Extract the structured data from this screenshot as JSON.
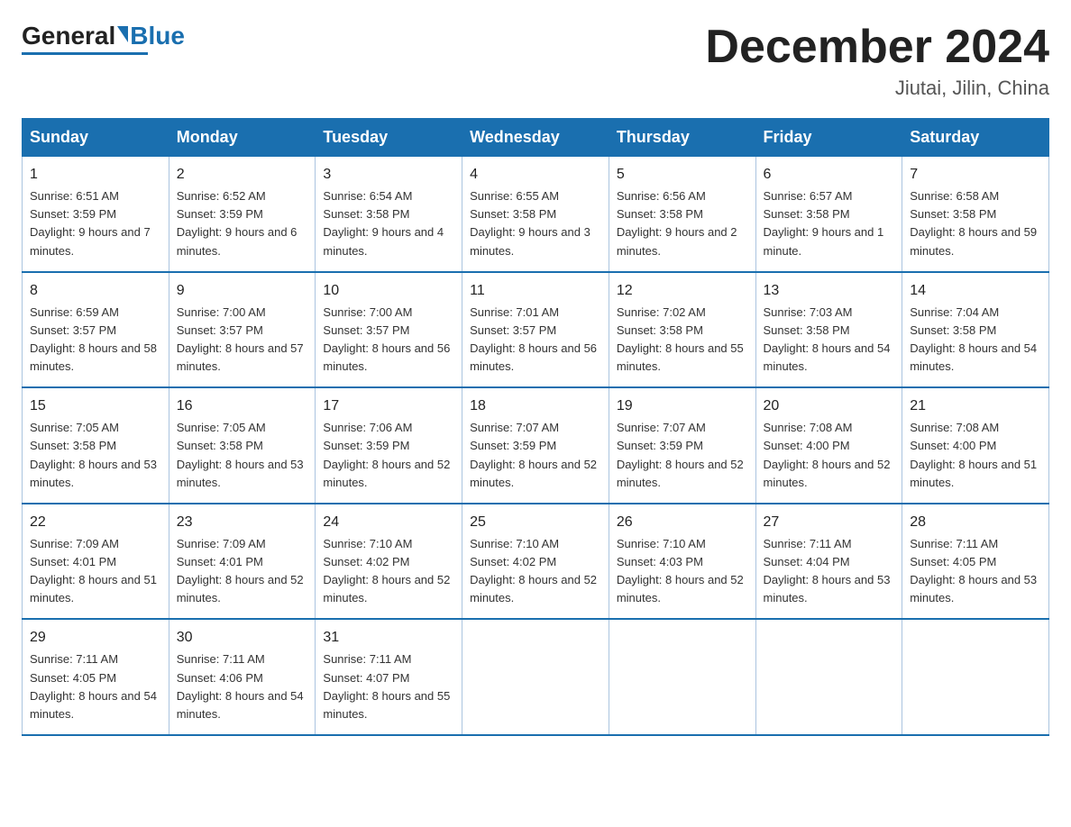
{
  "header": {
    "logo_general": "General",
    "logo_blue": "Blue",
    "month_title": "December 2024",
    "subtitle": "Jiutai, Jilin, China"
  },
  "weekdays": [
    "Sunday",
    "Monday",
    "Tuesday",
    "Wednesday",
    "Thursday",
    "Friday",
    "Saturday"
  ],
  "weeks": [
    [
      {
        "day": "1",
        "sunrise": "6:51 AM",
        "sunset": "3:59 PM",
        "daylight": "9 hours and 7 minutes."
      },
      {
        "day": "2",
        "sunrise": "6:52 AM",
        "sunset": "3:59 PM",
        "daylight": "9 hours and 6 minutes."
      },
      {
        "day": "3",
        "sunrise": "6:54 AM",
        "sunset": "3:58 PM",
        "daylight": "9 hours and 4 minutes."
      },
      {
        "day": "4",
        "sunrise": "6:55 AM",
        "sunset": "3:58 PM",
        "daylight": "9 hours and 3 minutes."
      },
      {
        "day": "5",
        "sunrise": "6:56 AM",
        "sunset": "3:58 PM",
        "daylight": "9 hours and 2 minutes."
      },
      {
        "day": "6",
        "sunrise": "6:57 AM",
        "sunset": "3:58 PM",
        "daylight": "9 hours and 1 minute."
      },
      {
        "day": "7",
        "sunrise": "6:58 AM",
        "sunset": "3:58 PM",
        "daylight": "8 hours and 59 minutes."
      }
    ],
    [
      {
        "day": "8",
        "sunrise": "6:59 AM",
        "sunset": "3:57 PM",
        "daylight": "8 hours and 58 minutes."
      },
      {
        "day": "9",
        "sunrise": "7:00 AM",
        "sunset": "3:57 PM",
        "daylight": "8 hours and 57 minutes."
      },
      {
        "day": "10",
        "sunrise": "7:00 AM",
        "sunset": "3:57 PM",
        "daylight": "8 hours and 56 minutes."
      },
      {
        "day": "11",
        "sunrise": "7:01 AM",
        "sunset": "3:57 PM",
        "daylight": "8 hours and 56 minutes."
      },
      {
        "day": "12",
        "sunrise": "7:02 AM",
        "sunset": "3:58 PM",
        "daylight": "8 hours and 55 minutes."
      },
      {
        "day": "13",
        "sunrise": "7:03 AM",
        "sunset": "3:58 PM",
        "daylight": "8 hours and 54 minutes."
      },
      {
        "day": "14",
        "sunrise": "7:04 AM",
        "sunset": "3:58 PM",
        "daylight": "8 hours and 54 minutes."
      }
    ],
    [
      {
        "day": "15",
        "sunrise": "7:05 AM",
        "sunset": "3:58 PM",
        "daylight": "8 hours and 53 minutes."
      },
      {
        "day": "16",
        "sunrise": "7:05 AM",
        "sunset": "3:58 PM",
        "daylight": "8 hours and 53 minutes."
      },
      {
        "day": "17",
        "sunrise": "7:06 AM",
        "sunset": "3:59 PM",
        "daylight": "8 hours and 52 minutes."
      },
      {
        "day": "18",
        "sunrise": "7:07 AM",
        "sunset": "3:59 PM",
        "daylight": "8 hours and 52 minutes."
      },
      {
        "day": "19",
        "sunrise": "7:07 AM",
        "sunset": "3:59 PM",
        "daylight": "8 hours and 52 minutes."
      },
      {
        "day": "20",
        "sunrise": "7:08 AM",
        "sunset": "4:00 PM",
        "daylight": "8 hours and 52 minutes."
      },
      {
        "day": "21",
        "sunrise": "7:08 AM",
        "sunset": "4:00 PM",
        "daylight": "8 hours and 51 minutes."
      }
    ],
    [
      {
        "day": "22",
        "sunrise": "7:09 AM",
        "sunset": "4:01 PM",
        "daylight": "8 hours and 51 minutes."
      },
      {
        "day": "23",
        "sunrise": "7:09 AM",
        "sunset": "4:01 PM",
        "daylight": "8 hours and 52 minutes."
      },
      {
        "day": "24",
        "sunrise": "7:10 AM",
        "sunset": "4:02 PM",
        "daylight": "8 hours and 52 minutes."
      },
      {
        "day": "25",
        "sunrise": "7:10 AM",
        "sunset": "4:02 PM",
        "daylight": "8 hours and 52 minutes."
      },
      {
        "day": "26",
        "sunrise": "7:10 AM",
        "sunset": "4:03 PM",
        "daylight": "8 hours and 52 minutes."
      },
      {
        "day": "27",
        "sunrise": "7:11 AM",
        "sunset": "4:04 PM",
        "daylight": "8 hours and 53 minutes."
      },
      {
        "day": "28",
        "sunrise": "7:11 AM",
        "sunset": "4:05 PM",
        "daylight": "8 hours and 53 minutes."
      }
    ],
    [
      {
        "day": "29",
        "sunrise": "7:11 AM",
        "sunset": "4:05 PM",
        "daylight": "8 hours and 54 minutes."
      },
      {
        "day": "30",
        "sunrise": "7:11 AM",
        "sunset": "4:06 PM",
        "daylight": "8 hours and 54 minutes."
      },
      {
        "day": "31",
        "sunrise": "7:11 AM",
        "sunset": "4:07 PM",
        "daylight": "8 hours and 55 minutes."
      },
      null,
      null,
      null,
      null
    ]
  ],
  "labels": {
    "sunrise": "Sunrise:",
    "sunset": "Sunset:",
    "daylight": "Daylight:"
  }
}
